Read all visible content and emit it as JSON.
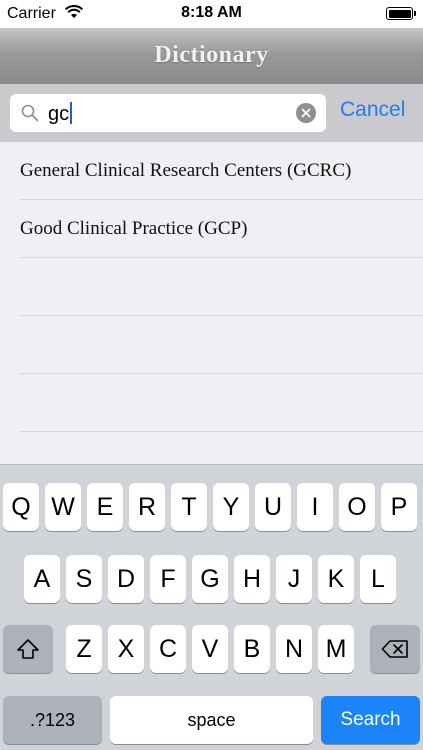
{
  "status_bar": {
    "carrier": "Carrier",
    "time": "8:18 AM",
    "battery_level": 1.0
  },
  "nav": {
    "title": "Dictionary"
  },
  "search": {
    "query": "gc",
    "cancel_label": "Cancel"
  },
  "results": [
    {
      "label": "General Clinical Research Centers (GCRC)"
    },
    {
      "label": "Good Clinical Practice (GCP)"
    },
    {
      "label": ""
    },
    {
      "label": ""
    },
    {
      "label": ""
    }
  ],
  "keyboard": {
    "row1": [
      "Q",
      "W",
      "E",
      "R",
      "T",
      "Y",
      "U",
      "I",
      "O",
      "P"
    ],
    "row2": [
      "A",
      "S",
      "D",
      "F",
      "G",
      "H",
      "J",
      "K",
      "L"
    ],
    "row3": [
      "Z",
      "X",
      "C",
      "V",
      "B",
      "N",
      "M"
    ],
    "numbers_label": ".?123",
    "space_label": "space",
    "search_label": "Search"
  },
  "colors": {
    "accent": "#1f7ef7",
    "search_key": "#1a84f8"
  }
}
